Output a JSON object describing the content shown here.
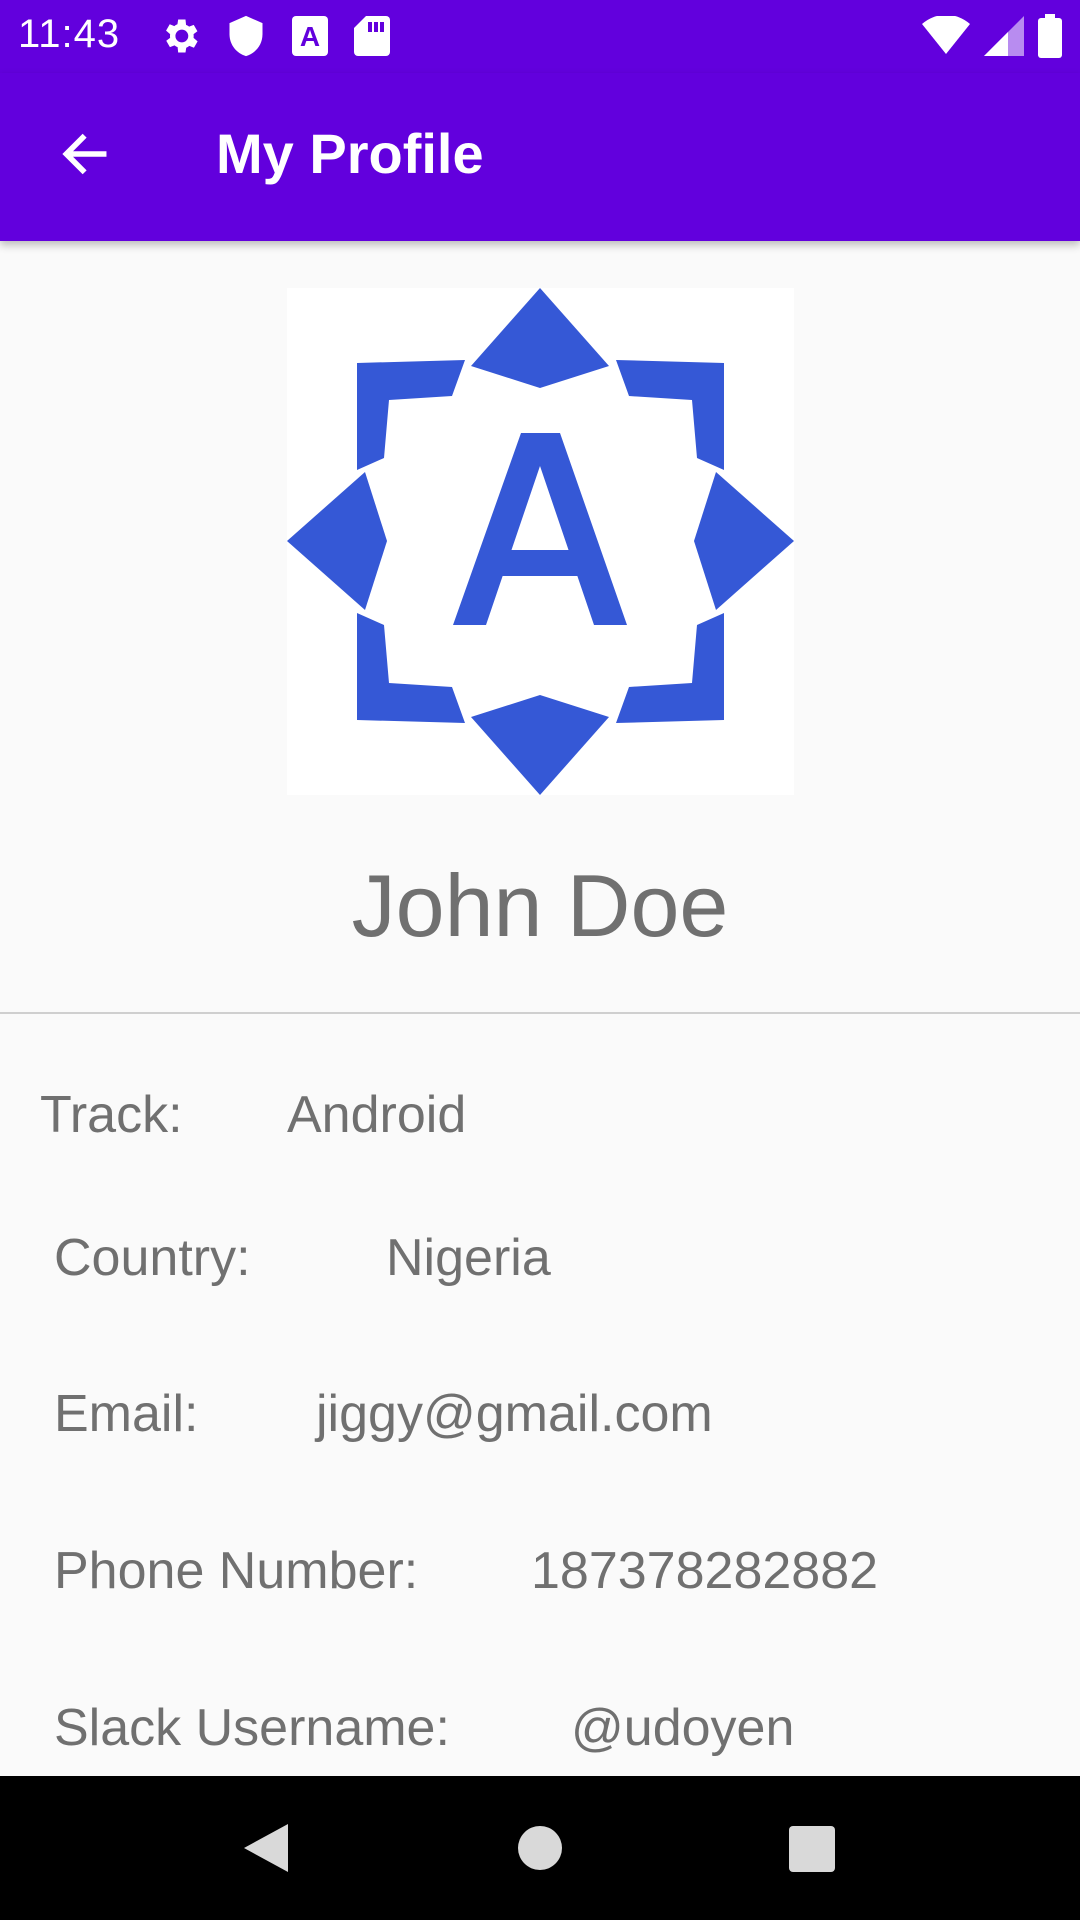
{
  "status_bar": {
    "time": "11:43",
    "icons": [
      "gear-icon",
      "shield-icon",
      "a-icon",
      "sd-card-icon",
      "wifi-icon",
      "cell-signal-icon",
      "battery-icon"
    ]
  },
  "app_bar": {
    "title": "My Profile",
    "back_icon": "arrow-back-icon",
    "color": "#6200dd"
  },
  "profile": {
    "avatar_icon": "star-badge-a-icon",
    "avatar_letter": "A",
    "avatar_color": "#3558d6",
    "name": "John Doe"
  },
  "fields": [
    {
      "label": "Track:",
      "value": "Android"
    },
    {
      "label": "Country:",
      "value": "Nigeria"
    },
    {
      "label": "Email:",
      "value": "jiggy@gmail.com"
    },
    {
      "label": "Phone Number:",
      "value": "187378282882"
    },
    {
      "label": "Slack Username:",
      "value": "@udoyen"
    }
  ],
  "nav_bar": {
    "buttons": [
      "back-triangle-icon",
      "home-circle-icon",
      "recents-square-icon"
    ]
  }
}
